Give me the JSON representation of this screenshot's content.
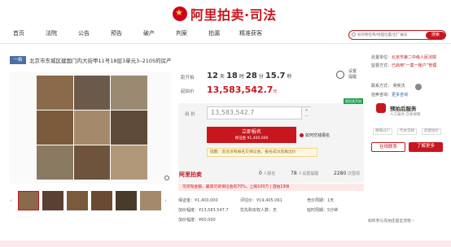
{
  "header": {
    "brand": "阿里拍卖·司法"
  },
  "nav": {
    "items": [
      "首页",
      "法院",
      "公告",
      "预告",
      "破产",
      "判案",
      "拍漏",
      "精准获客"
    ],
    "search_placeholder": "标的物名称/地理位置/出厂编号",
    "search_button": "搜索"
  },
  "listing": {
    "tag": "一拍",
    "title": "北京市东城区建国门内大街甲11号18层3单元3–2105的房产"
  },
  "auction": {
    "countdown_label": "距开拍",
    "days": "12",
    "hours": "18",
    "minutes": "28",
    "seconds": "15.7",
    "unit_day": "天",
    "unit_hour": "时",
    "unit_min": "分",
    "unit_sec": "秒",
    "start_price_label": "起拍价",
    "start_price": "13,583,542.7",
    "price_unit": "元",
    "remind_label_1": "设置",
    "remind_label_2": "提醒",
    "bid_label": "出 价",
    "bid_value": "13,583,542.7",
    "apply_button_line1": "立即报名",
    "apply_button_line2": "保证金 ¥1,400,000",
    "how_link": "如何交钱报名",
    "tip": "提醒：您还没有报名交保证金，报名成功后再出价",
    "countdown_tag": "距拍卖开始"
  },
  "stats": {
    "logo": "阿里拍卖",
    "enrolled": "0",
    "enrolled_label": "人报名",
    "reminders": "78",
    "reminders_label": "人设置提醒",
    "views": "2280",
    "views_label": "次围观"
  },
  "loan_bar": "可贷现金额，最高可贷保证金的70%，上限100万  | 首拍19领",
  "info": {
    "deposit": "保证金：¥1,400,000",
    "eval": "评估价：¥19,405,061",
    "cycle": "竞价周期：1天",
    "increment": "加价幅度：¥13,583,547.7",
    "priority": "优先购买权人数：无",
    "delay": "延时周期：5分钟",
    "min_increment": "加价幅度：¥60,000"
  },
  "right": {
    "court_label": "处置单位：",
    "court_name": "北京市第二中级人民法院",
    "status_label": "监督方式：",
    "status_value": "已启用“一案一账户”管理",
    "contact_label": "联系方式：",
    "contact_name": "吴奕法",
    "consult_label": "拍卖咨询：",
    "consult_link": "更多咨询",
    "assist_name": "预拍后服务",
    "assist_sub": "人工服务·交易保障",
    "chips": [
      "保障过户",
      "代办贷款",
      "房屋估价"
    ],
    "online_btn": "在线联系",
    "more_btn": "了解更多",
    "flow_text": "如何参与竞拍还是全流程",
    "flow_link": "›"
  }
}
